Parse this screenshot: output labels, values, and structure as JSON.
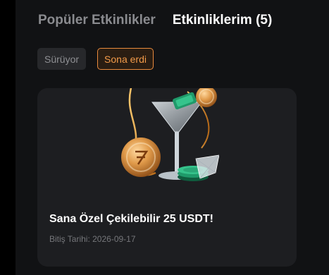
{
  "tabs": [
    {
      "label": "Popüler Etkinlikler",
      "active": false
    },
    {
      "label": "Etkinliklerim (5)",
      "active": true
    }
  ],
  "filters": [
    {
      "label": "Sürüyor",
      "selected": false
    },
    {
      "label": "Sona erdi",
      "selected": true
    }
  ],
  "event_card": {
    "title": "Sana Özel Çekilebilir 25 USDT!",
    "end_date": "Bitiş Tarihi: 2026-09-17",
    "image": "martini-glass-coins-and-chips-illustration"
  },
  "colors": {
    "accent": "#f29a49",
    "background": "#111214",
    "card": "#1d1e21"
  }
}
